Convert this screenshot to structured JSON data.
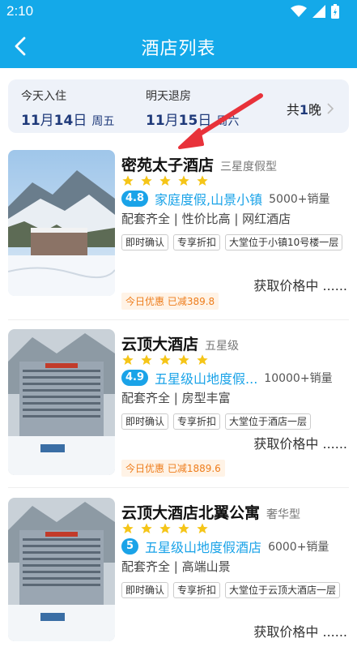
{
  "status_bar": {
    "time": "2:10"
  },
  "header": {
    "title": "酒店列表"
  },
  "dates": {
    "checkin_label": "今天入住",
    "checkin_month": "11",
    "checkin_day": "14",
    "checkin_weekday": "周五",
    "checkout_label": "明天退房",
    "checkout_month": "11",
    "checkout_day": "15",
    "checkout_weekday": "周六",
    "nights_prefix": "共",
    "nights_count": "1",
    "nights_suffix": "晚"
  },
  "hotels": [
    {
      "name": "密苑太子酒店",
      "grade": "三星度假型",
      "score": "4.8",
      "desc": "家庭度假,山景小镇",
      "sales": "5000+销量",
      "features": "配套齐全 | 性价比高 | 网红酒店",
      "tags": [
        "即时确认",
        "专享折扣",
        "大堂位于小镇10号楼一层"
      ],
      "price": "获取价格中 ......",
      "discount": "今日优惠 已减389.8"
    },
    {
      "name": "云顶大酒店",
      "grade": "五星级",
      "score": "4.9",
      "desc": "五星级山地度假...",
      "sales": "10000+销量",
      "features": "配套齐全 | 房型丰富",
      "tags": [
        "即时确认",
        "专享折扣",
        "大堂位于酒店一层"
      ],
      "price": "获取价格中 ......",
      "discount": "今日优惠 已减1889.6"
    },
    {
      "name": "云顶大酒店北翼公寓",
      "grade": "奢华型",
      "score": "5",
      "desc": "五星级山地度假酒店",
      "sales": "6000+销量",
      "features": "配套齐全 | 高端山景",
      "tags": [
        "即时确认",
        "专享折扣",
        "大堂位于云顶大酒店一层"
      ],
      "price": "获取价格中 ......"
    }
  ],
  "colors": {
    "primary": "#14a9e9",
    "score": "#1aa3e8",
    "star": "#f5c518",
    "discount": "#ee7d1c",
    "annotation": "#e8323a"
  }
}
